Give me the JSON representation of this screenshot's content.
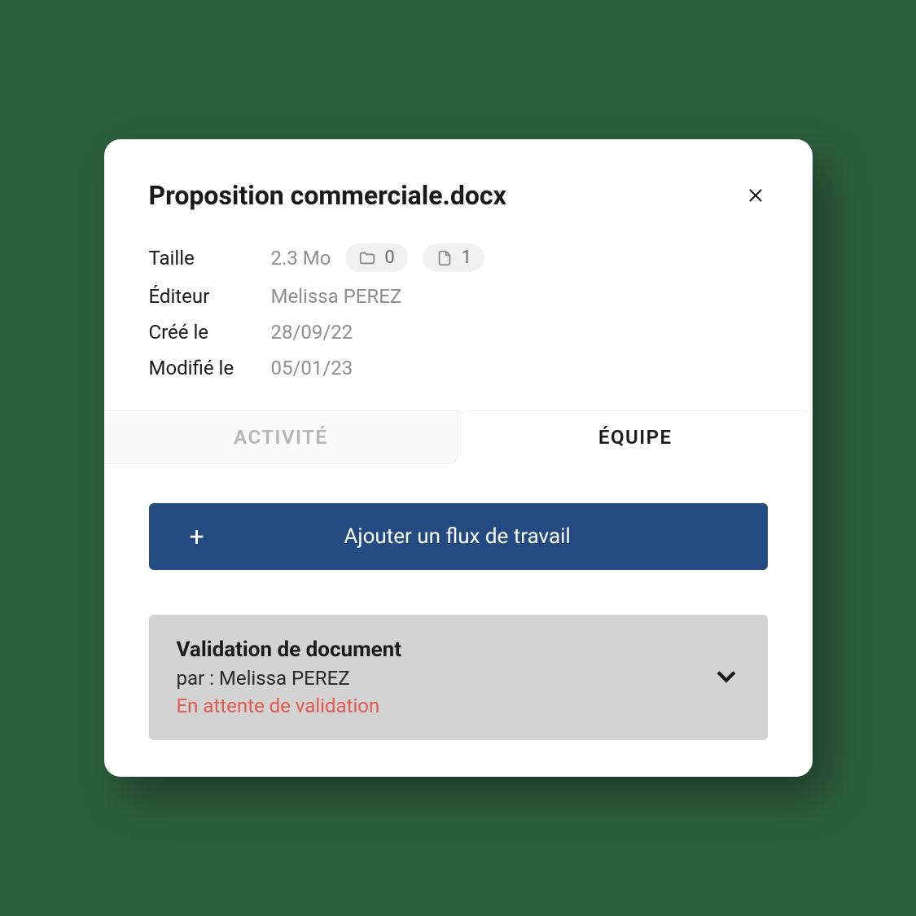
{
  "header": {
    "title": "Proposition commerciale.docx"
  },
  "meta": {
    "size_label": "Taille",
    "size_value": "2.3 Mo",
    "folder_count": "0",
    "file_count": "1",
    "editor_label": "Éditeur",
    "editor_value": "Melissa PEREZ",
    "created_label": "Créé le",
    "created_value": "28/09/22",
    "modified_label": "Modifié le",
    "modified_value": "05/01/23"
  },
  "tabs": {
    "activity": "ACTIVITÉ",
    "team": "ÉQUIPE"
  },
  "add_workflow": {
    "icon": "+",
    "label": "Ajouter un flux de travail"
  },
  "workflow": {
    "title": "Validation de document",
    "by_prefix": "par : ",
    "by_name": "Melissa PEREZ",
    "status": "En attente de validation"
  },
  "colors": {
    "primary": "#234b82",
    "status_warn": "#e05a4f",
    "background": "#2d5f3f"
  }
}
